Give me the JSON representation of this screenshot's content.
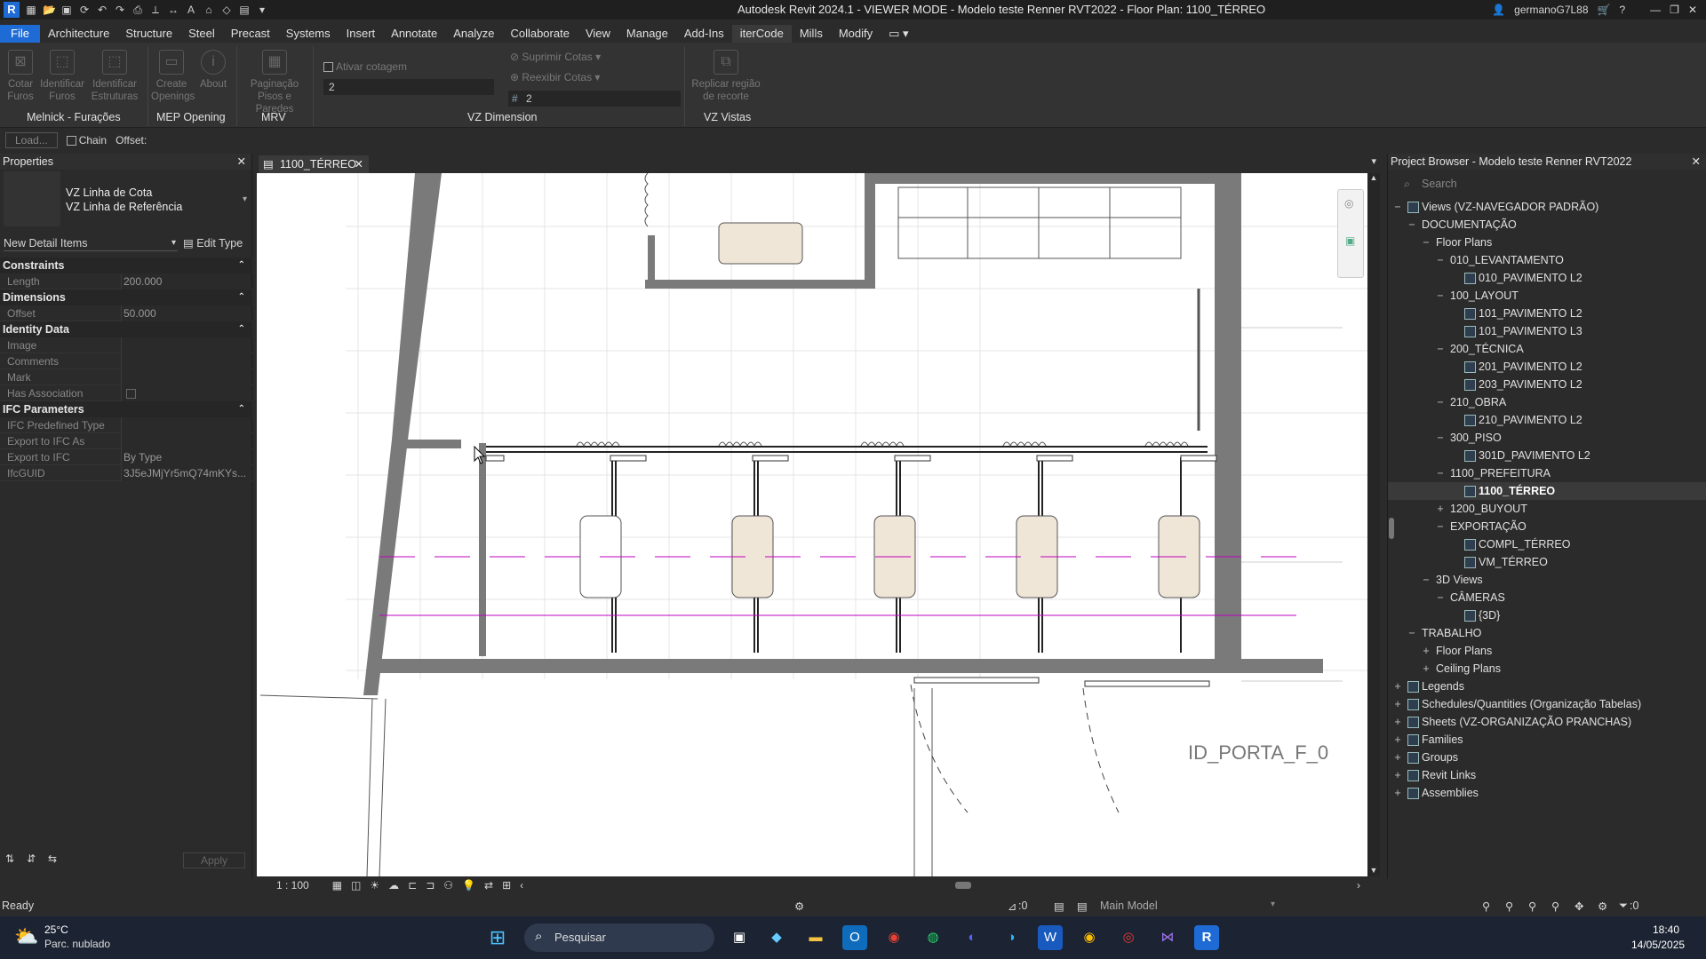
{
  "titlebar": {
    "title": "Autodesk Revit 2024.1 - VIEWER MODE - Modelo teste Renner RVT2022 - Floor Plan: 1100_TÉRREO",
    "user": "germanoG7L88",
    "help": "?"
  },
  "menu": [
    "File",
    "Architecture",
    "Structure",
    "Steel",
    "Precast",
    "Systems",
    "Insert",
    "Annotate",
    "Analyze",
    "Collaborate",
    "View",
    "Manage",
    "Add-Ins",
    "iterCode",
    "Mills",
    "Modify"
  ],
  "ribbon": {
    "buttons": [
      {
        "label1": "Cotar",
        "label2": "Furos"
      },
      {
        "label1": "Identificar",
        "label2": "Furos"
      },
      {
        "label1": "Identificar",
        "label2": "Estruturas"
      },
      {
        "label1": "Create",
        "label2": "Openings"
      },
      {
        "label1": "About",
        "label2": ""
      },
      {
        "label1": "Paginação",
        "label2": "Pisos e Paredes"
      }
    ],
    "ativar_cotagem": "Ativar cotagem",
    "suprimir_cotas": "Suprimir Cotas",
    "reexibir_cotas": "Reexibir Cotas",
    "field1_value": "2",
    "field2_value": "2",
    "replicar_line1": "Replicar região",
    "replicar_line2": "de recorte",
    "panels": [
      "Melnick - Furações",
      "MEP Opening",
      "MRV",
      "VZ Dimension",
      "VZ Vistas"
    ]
  },
  "options": {
    "load": "Load...",
    "chain": "Chain",
    "offset": "Offset:"
  },
  "properties": {
    "title": "Properties",
    "type_line1": "VZ Linha de Cota",
    "type_line2": "VZ Linha de Referência",
    "instance": "New Detail Items",
    "edit_type": "Edit Type",
    "categories": [
      {
        "name": "Constraints",
        "rows": [
          {
            "k": "Length",
            "v": "200.000"
          }
        ]
      },
      {
        "name": "Dimensions",
        "rows": [
          {
            "k": "Offset",
            "v": "50.000"
          }
        ]
      },
      {
        "name": "Identity Data",
        "rows": [
          {
            "k": "Image",
            "v": ""
          },
          {
            "k": "Comments",
            "v": ""
          },
          {
            "k": "Mark",
            "v": ""
          },
          {
            "k": "Has Association",
            "v": ""
          }
        ]
      },
      {
        "name": "IFC Parameters",
        "rows": [
          {
            "k": "IFC Predefined Type",
            "v": ""
          },
          {
            "k": "Export to IFC As",
            "v": ""
          },
          {
            "k": "Export to IFC",
            "v": "By Type"
          },
          {
            "k": "IfcGUID",
            "v": "3J5eJMjYr5mQ74mKYs..."
          }
        ]
      }
    ],
    "apply": "Apply"
  },
  "view": {
    "tab": "1100_TÉRREO",
    "scale": "1 : 100",
    "tag_text": "ID_PORTA_F_0"
  },
  "browser": {
    "title": "Project Browser - Modelo teste Renner RVT2022",
    "search_placeholder": "Search",
    "items": [
      {
        "label": "Views (VZ-NAVEGADOR PADRÃO)",
        "level": 0,
        "tog": "−",
        "icon": true
      },
      {
        "label": "DOCUMENTAÇÃO",
        "level": 1,
        "tog": "−"
      },
      {
        "label": "Floor Plans",
        "level": 2,
        "tog": "−"
      },
      {
        "label": "010_LEVANTAMENTO",
        "level": 3,
        "tog": "−"
      },
      {
        "label": "010_PAVIMENTO L2",
        "level": 4,
        "icon": true
      },
      {
        "label": "100_LAYOUT",
        "level": 3,
        "tog": "−"
      },
      {
        "label": "101_PAVIMENTO L2",
        "level": 4,
        "icon": true
      },
      {
        "label": "101_PAVIMENTO L3",
        "level": 4,
        "icon": true
      },
      {
        "label": "200_TÉCNICA",
        "level": 3,
        "tog": "−"
      },
      {
        "label": "201_PAVIMENTO L2",
        "level": 4,
        "icon": true
      },
      {
        "label": "203_PAVIMENTO L2",
        "level": 4,
        "icon": true
      },
      {
        "label": "210_OBRA",
        "level": 3,
        "tog": "−"
      },
      {
        "label": "210_PAVIMENTO L2",
        "level": 4,
        "icon": true
      },
      {
        "label": "300_PISO",
        "level": 3,
        "tog": "−"
      },
      {
        "label": "301D_PAVIMENTO L2",
        "level": 4,
        "icon": true
      },
      {
        "label": "1100_PREFEITURA",
        "level": 3,
        "tog": "−"
      },
      {
        "label": "1100_TÉRREO",
        "level": 4,
        "icon": true,
        "selected": true
      },
      {
        "label": "1200_BUYOUT",
        "level": 3,
        "tog": "+"
      },
      {
        "label": "EXPORTAÇÃO",
        "level": 3,
        "tog": "−"
      },
      {
        "label": "COMPL_TÉRREO",
        "level": 4,
        "icon": true
      },
      {
        "label": "VM_TÉRREO",
        "level": 4,
        "icon": true
      },
      {
        "label": "3D Views",
        "level": 2,
        "tog": "−"
      },
      {
        "label": "CÂMERAS",
        "level": 3,
        "tog": "−"
      },
      {
        "label": "{3D}",
        "level": 4,
        "icon": true
      },
      {
        "label": "TRABALHO",
        "level": 1,
        "tog": "−"
      },
      {
        "label": "Floor Plans",
        "level": 2,
        "tog": "+"
      },
      {
        "label": "Ceiling Plans",
        "level": 2,
        "tog": "+"
      },
      {
        "label": "Legends",
        "level": 0,
        "tog": "+",
        "icon": true
      },
      {
        "label": "Schedules/Quantities (Organização Tabelas)",
        "level": 0,
        "tog": "+",
        "icon": true
      },
      {
        "label": "Sheets (VZ-ORGANIZAÇÃO PRANCHAS)",
        "level": 0,
        "tog": "+",
        "icon": true
      },
      {
        "label": "Families",
        "level": 0,
        "tog": "+",
        "icon": true
      },
      {
        "label": "Groups",
        "level": 0,
        "tog": "+",
        "icon": true
      },
      {
        "label": "Revit Links",
        "level": 0,
        "tog": "+",
        "icon": true
      },
      {
        "label": "Assemblies",
        "level": 0,
        "tog": "+",
        "icon": true
      }
    ]
  },
  "status": {
    "ready": "Ready",
    "sel_count": ":0",
    "model": "Main Model",
    "filter_count": ":0"
  },
  "taskbar": {
    "temp": "25°C",
    "weather": "Parc. nublado",
    "search": "Pesquisar",
    "time": "18:40",
    "date": "14/05/2025"
  }
}
